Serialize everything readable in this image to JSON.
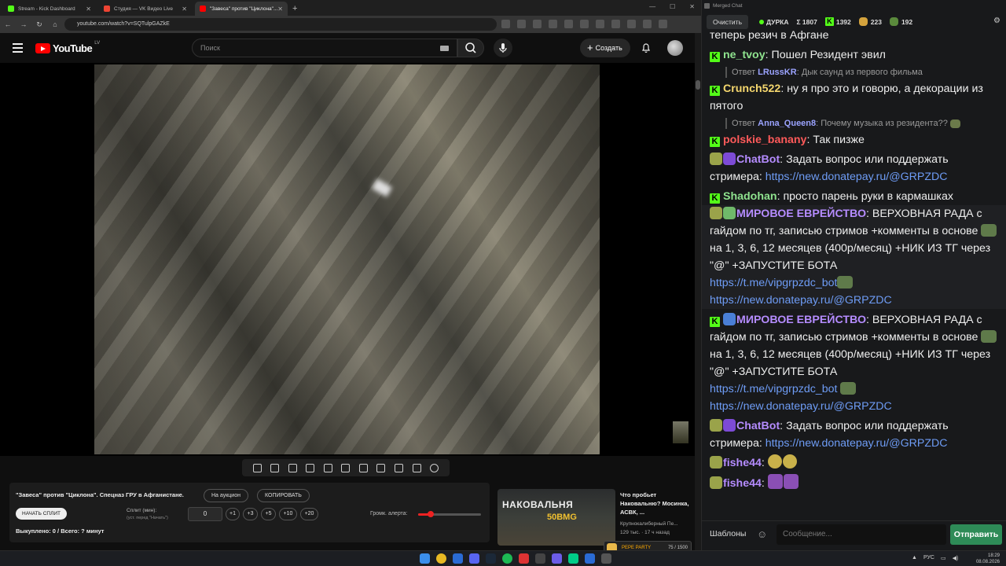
{
  "browser": {
    "tabs": [
      {
        "label": "Stream - Kick Dashboard",
        "color": "#53fc18"
      },
      {
        "label": "Студия — VK Видео Live",
        "color": "#e43"
      },
      {
        "label": "\"Завеса\" против \"Циклона\"...",
        "color": "#f00"
      }
    ],
    "url": "youtube.com/watch?v=SQTulpGAZkE"
  },
  "youtube": {
    "logo": "YouTube",
    "country": "LV",
    "search_placeholder": "Поиск",
    "create_label": "Создать"
  },
  "panel": {
    "title": "\"Завеса\" против \"Циклона\". Спецназ ГРУ в Афганистане.",
    "auction_label": "На аукцион",
    "copy_label": "КОПИРОВАТЬ",
    "start_split_label": "НАЧАТЬ СПЛИТ",
    "split_label": "Сплит (мин):",
    "split_hint": "(уст. перед \"Начать\")",
    "split_value": "0",
    "increments": [
      "+1",
      "+3",
      "+5",
      "+10",
      "+20"
    ],
    "bought_text": "Выкуплено: 0 / Всего: ? минут",
    "volume_label": "Громк. алерта:",
    "volume_level": 0.2
  },
  "recommendation": {
    "thumb_text1": "НАКОВАЛЬНЯ",
    "thumb_text2": "50BMG",
    "title": "Что пробьет Наковальню? Мосинка, АСВК, ...",
    "channel": "Крупнокалиберный Пе...",
    "stats": "129 тыс. · 17 ч назад"
  },
  "chat": {
    "window_title": "Merged Chat",
    "clear_label": "Очистить",
    "stream_status": "ДУРКА",
    "stats": {
      "total": "Σ 1807",
      "kick": "1392",
      "vk": "223",
      "yt": "192"
    },
    "messages": [
      {
        "type": "plain",
        "text": "теперь резич в Афгане"
      },
      {
        "type": "kick",
        "user": "ne_tvoy",
        "color": "#8fe38f",
        "text": "Пошел Резидент эвил"
      },
      {
        "type": "reply",
        "reply_prefix": "Ответ",
        "reply_user": "LRussKR",
        "reply_text": "Дык саунд из первого фильма"
      },
      {
        "type": "kick",
        "user": "Crunch522",
        "color": "#f5d76e",
        "text": "ну я про это и говорю, а декорации из пятого"
      },
      {
        "type": "reply",
        "reply_prefix": "Ответ",
        "reply_user": "Anna_Queen8",
        "reply_text": "Почему музыка из резидента??"
      },
      {
        "type": "kick",
        "user": "polskie_banany",
        "color": "#ff5a5a",
        "text": "Так пизже"
      },
      {
        "type": "bot",
        "user": "ChatBot",
        "color": "#b58cff",
        "text": "Задать вопрос или поддержать стримера: ",
        "link": "https://new.donatepay.ru/@GRPZDC"
      },
      {
        "type": "kick",
        "user": "Shadohan",
        "color": "#8fe38f",
        "text": "просто парень руки в кармашках"
      },
      {
        "type": "promo",
        "user": "МИРОВОЕ ЕВРЕЙСТВО",
        "color": "#b58cff",
        "text1": "ВЕРХОВНАЯ РАДА с гайдом по тг, записью стримов +комменты в основе",
        "text2": "на 1, 3, 6, 12 месяцев (400р/месяц) +НИК ИЗ ТГ через \"@\" +ЗАПУСТИТЕ БОТА",
        "link1": "https://t.me/vipgrpzdc_bot",
        "link2": "https://new.donatepay.ru/@GRPZDC"
      },
      {
        "type": "promo2",
        "user": "МИРОВОЕ ЕВРЕЙСТВО",
        "color": "#b58cff",
        "text1": "ВЕРХОВНАЯ РАДА с гайдом по тг, записью стримов +комменты в основе",
        "text2": "на 1, 3, 6, 12 месяцев (400р/месяц) +НИК ИЗ ТГ через \"@\" +ЗАПУСТИТЕ БОТА",
        "link1": "https://t.me/vipgrpzdc_bot",
        "link2": "https://new.donatepay.ru/@GRPZDC"
      },
      {
        "type": "bot",
        "user": "ChatBot",
        "color": "#b58cff",
        "text": "Задать вопрос или поддержать стримера: ",
        "link": "https://new.donatepay.ru/@GRPZDC"
      },
      {
        "type": "emote",
        "user": "fishe44",
        "color": "#b58cff"
      },
      {
        "type": "emote",
        "user": "fishe44",
        "color": "#b58cff"
      }
    ],
    "templates_label": "Шаблоны",
    "input_placeholder": "Сообщение...",
    "send_label": "Отправить"
  },
  "overlay": {
    "title": "PEPE PARTY",
    "progress": "75 / 1500"
  },
  "taskbar": {
    "lang": "РУС",
    "time": "18:29",
    "date": "08.08.2026"
  }
}
